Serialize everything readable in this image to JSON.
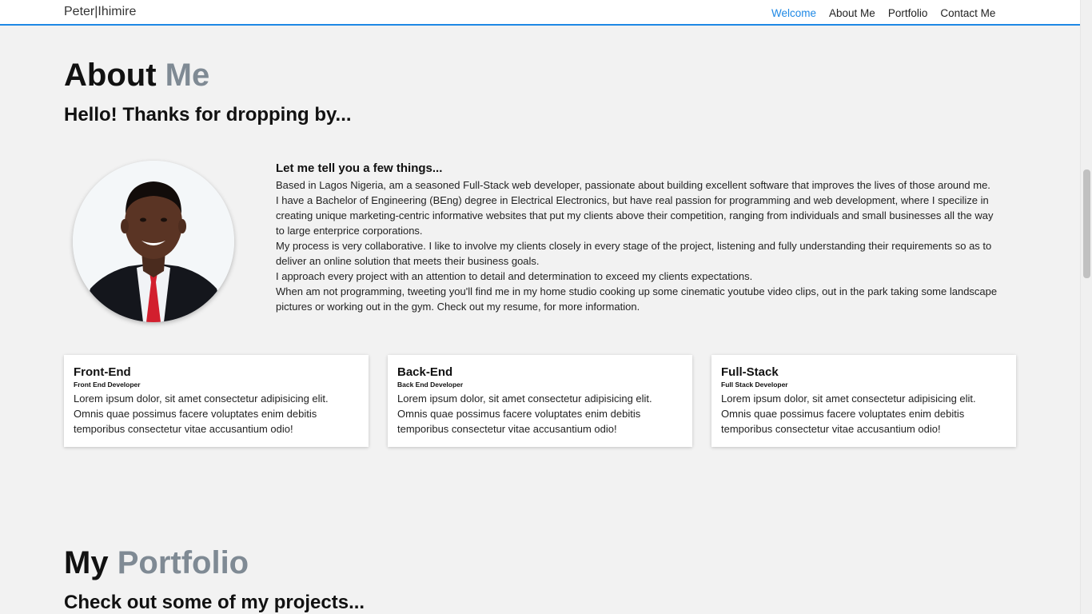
{
  "navbar": {
    "brand": "Peter|Ihimire",
    "links": [
      {
        "label": "Welcome",
        "active": true
      },
      {
        "label": "About Me",
        "active": false
      },
      {
        "label": "Portfolio",
        "active": false
      },
      {
        "label": "Contact Me",
        "active": false
      }
    ],
    "accent_color": "#1e88e5"
  },
  "about": {
    "title_main": "About",
    "title_accent": "Me",
    "subtitle": "Hello! Thanks for dropping by...",
    "avatar_icon": "profile-photo",
    "bio_heading": "Let me tell you a few things...",
    "paragraphs": [
      "Based in Lagos Nigeria, am a seasoned Full-Stack web developer, passionate about building excellent software that improves the lives of those around me.",
      "I have a Bachelor of Engineering (BEng) degree in Electrical Electronics, but have real passion for programming and web development, where I specilize in creating unique marketing-centric informative websites that put my clients above their competition, ranging from individuals and small businesses all the way to large enterprice corporations.",
      "My process is very collaborative. I like to involve my clients closely in every stage of the project, listening and fully understanding their requirements so as to deliver an online solution that meets their business goals.",
      "I approach every project with an attention to detail and determination to exceed my clients expectations.",
      "When am not programming, tweeting you'll find me in my home studio cooking up some cinematic youtube video clips, out in the park taking some landscape pictures or working out in the gym. Check out my resume, for more information."
    ]
  },
  "cards": [
    {
      "title": "Front-End",
      "subtitle": "Front End Developer",
      "text": "Lorem ipsum dolor, sit amet consectetur adipisicing elit. Omnis quae possimus facere voluptates enim debitis temporibus consectetur vitae accusantium odio!"
    },
    {
      "title": "Back-End",
      "subtitle": "Back End Developer",
      "text": "Lorem ipsum dolor, sit amet consectetur adipisicing elit. Omnis quae possimus facere voluptates enim debitis temporibus consectetur vitae accusantium odio!"
    },
    {
      "title": "Full-Stack",
      "subtitle": "Full Stack Developer",
      "text": "Lorem ipsum dolor, sit amet consectetur adipisicing elit. Omnis quae possimus facere voluptates enim debitis temporibus consectetur vitae accusantium odio!"
    }
  ],
  "portfolio": {
    "title_main": "My",
    "title_accent": "Portfolio",
    "subtitle": "Check out some of my projects..."
  }
}
